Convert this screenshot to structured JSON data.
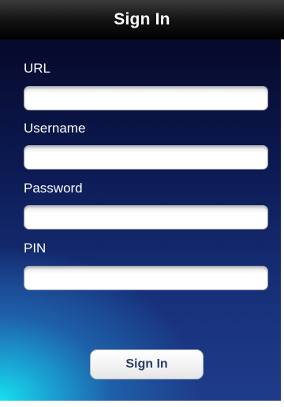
{
  "header": {
    "title": "Sign In"
  },
  "form": {
    "url": {
      "label": "URL",
      "value": "",
      "placeholder": ""
    },
    "username": {
      "label": "Username",
      "value": "",
      "placeholder": ""
    },
    "password": {
      "label": "Password",
      "value": "",
      "placeholder": ""
    },
    "pin": {
      "label": "PIN",
      "value": "",
      "placeholder": ""
    }
  },
  "actions": {
    "sign_in_label": "Sign In"
  },
  "colors": {
    "header": "#000000",
    "background_dark": "#0c1a52",
    "background_glow": "#17e1ee",
    "button_text": "#2a3f66"
  }
}
